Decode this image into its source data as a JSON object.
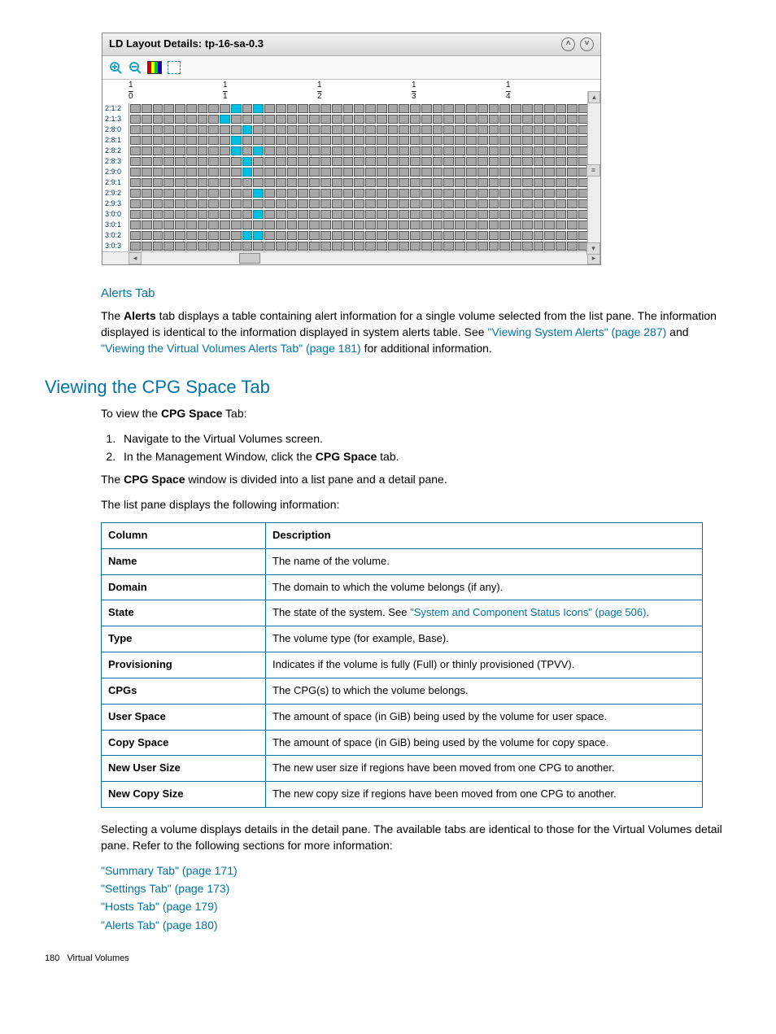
{
  "window": {
    "title": "LD Layout Details: tp-16-sa-0.3",
    "ruler": [
      "1/0",
      "1/1",
      "1/2",
      "1/3",
      "1/4"
    ],
    "rows": [
      {
        "label": "2:1:2",
        "on": [
          9,
          11
        ]
      },
      {
        "label": "2:1:3",
        "on": [
          8
        ]
      },
      {
        "label": "2:8:0",
        "on": [
          10
        ]
      },
      {
        "label": "2:8:1",
        "on": [
          9
        ]
      },
      {
        "label": "2:8:2",
        "on": [
          9,
          11
        ]
      },
      {
        "label": "2:8:3",
        "on": [
          10
        ]
      },
      {
        "label": "2:9:0",
        "on": [
          10
        ]
      },
      {
        "label": "2:9:1",
        "on": []
      },
      {
        "label": "2:9:2",
        "on": [
          11
        ]
      },
      {
        "label": "2:9:3",
        "on": []
      },
      {
        "label": "3:0:0",
        "on": [
          11
        ]
      },
      {
        "label": "3:0:1",
        "on": []
      },
      {
        "label": "3:0:2",
        "on": [
          10,
          11
        ]
      },
      {
        "label": "3:0:3",
        "on": []
      }
    ],
    "cols": 42
  },
  "alerts": {
    "heading": "Alerts Tab",
    "para_a": "The ",
    "para_bold": "Alerts",
    "para_b": " tab displays a table containing alert information for a single volume selected from the list pane. The information displayed is identical to the information displayed in system alerts table. See ",
    "link1": "\"Viewing System Alerts\" (page 287)",
    "para_c": " and ",
    "link2": "\"Viewing the Virtual Volumes Alerts Tab\" (page 181)",
    "para_d": " for additional information."
  },
  "cpg": {
    "heading": "Viewing the CPG Space Tab",
    "intro_a": "To view the ",
    "intro_bold": "CPG Space",
    "intro_b": " Tab:",
    "step1": "Navigate to the Virtual Volumes screen.",
    "step2_a": "In the Management Window, click the ",
    "step2_bold": "CPG Space",
    "step2_b": " tab.",
    "after1_a": "The ",
    "after1_bold": "CPG Space",
    "after1_b": " window is divided into a list pane and a detail pane.",
    "after2": "The list pane displays the following information:"
  },
  "table": {
    "h1": "Column",
    "h2": "Description",
    "rows": [
      {
        "c": "Name",
        "d": "The name of the volume."
      },
      {
        "c": "Domain",
        "d": "The domain to which the volume belongs (if any)."
      },
      {
        "c": "State",
        "d_pre": "The state of the system. See ",
        "d_link": "\"System and Component Status Icons\" (page 506)",
        "d_post": "."
      },
      {
        "c": "Type",
        "d": "The volume type (for example, Base)."
      },
      {
        "c": "Provisioning",
        "d": "Indicates if the volume is fully (Full) or thinly provisioned (TPVV)."
      },
      {
        "c": "CPGs",
        "d": "The CPG(s) to which the volume belongs."
      },
      {
        "c": "User Space",
        "d": "The amount of space (in GiB) being used by the volume for user space."
      },
      {
        "c": "Copy Space",
        "d": "The amount of space (in GiB) being used by the volume for copy space."
      },
      {
        "c": "New User Size",
        "d": "The new user size if regions have been moved from one CPG to another."
      },
      {
        "c": "New Copy Size",
        "d": "The new copy size if regions have been moved from one CPG to another."
      }
    ]
  },
  "closing": {
    "para": "Selecting a volume displays details in the detail pane. The available tabs are identical to those for the Virtual Volumes detail pane. Refer to the following sections for more information:",
    "links": [
      "\"Summary Tab\" (page 171)",
      "\"Settings Tab\" (page 173)",
      "\"Hosts Tab\" (page 179)",
      "\"Alerts Tab\" (page 180)"
    ]
  },
  "footer": {
    "page": "180",
    "section": "Virtual Volumes"
  }
}
